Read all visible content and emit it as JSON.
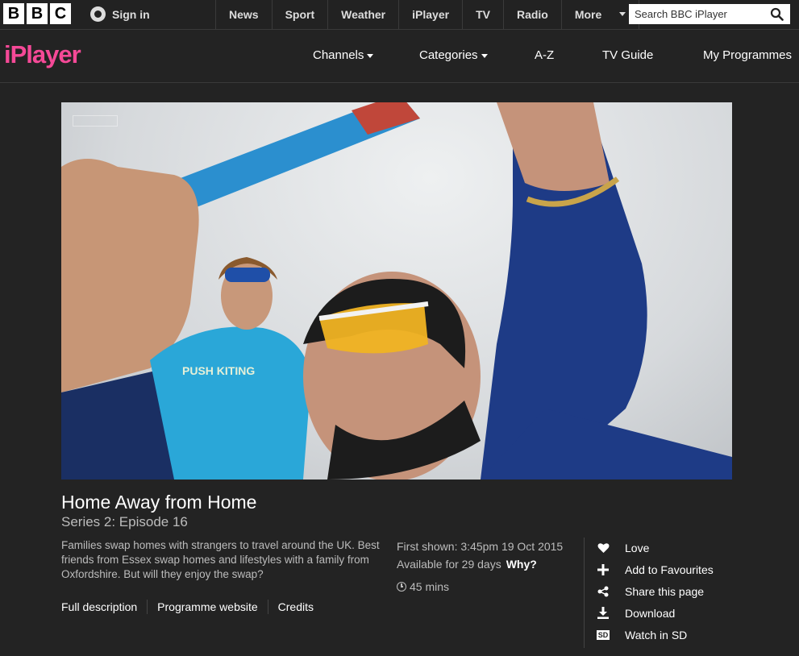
{
  "global": {
    "logo_letters": [
      "B",
      "B",
      "C"
    ],
    "sign_in": "Sign in",
    "nav": [
      "News",
      "Sport",
      "Weather",
      "iPlayer",
      "TV",
      "Radio"
    ],
    "more": "More",
    "search_placeholder": "Search BBC iPlayer"
  },
  "iplayer": {
    "logo": "iPlayer",
    "nav": {
      "channels": "Channels",
      "categories": "Categories",
      "az": "A-Z",
      "tv_guide": "TV Guide",
      "my_programmes": "My Programmes"
    }
  },
  "programme": {
    "title": "Home Away from Home",
    "subtitle": "Series 2: Episode 16",
    "description": "Families swap homes with strangers to travel around the UK. Best friends from Essex swap homes and lifestyles with a family from Oxfordshire. But will they enjoy the swap?",
    "links": [
      "Full description",
      "Programme website",
      "Credits"
    ],
    "first_shown": "First shown: 3:45pm 19 Oct 2015",
    "available": "Available for 29 days",
    "why": "Why?",
    "duration": "45 mins"
  },
  "actions": {
    "love": "Love",
    "favourites": "Add to Favourites",
    "share": "Share this page",
    "download": "Download",
    "watch_sd": "Watch in SD",
    "sd_badge": "SD"
  },
  "colors": {
    "brand_pink": "#f54997",
    "background": "#232323"
  }
}
